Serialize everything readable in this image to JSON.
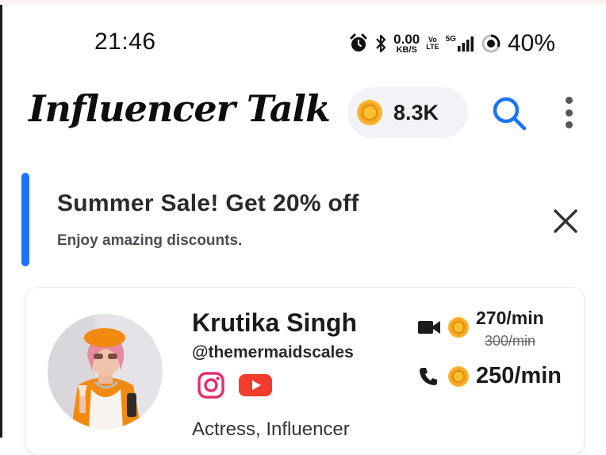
{
  "status_bar": {
    "time": "21:46",
    "net_speed_value": "0.00",
    "net_speed_unit": "KB/S",
    "volte_top": "Vo",
    "volte_bottom": "LTE",
    "network": "5G",
    "battery": "40%"
  },
  "header": {
    "title": "Influencer Talk",
    "coins": "8.3K",
    "accent_color": "#1a73f8",
    "coin_color": "#f5a623"
  },
  "banner": {
    "title": "Summer Sale! Get 20% off",
    "subtitle": "Enjoy amazing discounts."
  },
  "influencer": {
    "name": "Krutika Singh",
    "handle": "@themermaidscales",
    "category": "Actress, Influencer",
    "video_price": "270/min",
    "video_price_old": "300/min",
    "call_price": "250/min",
    "socials": [
      "instagram-icon",
      "youtube-icon"
    ]
  }
}
